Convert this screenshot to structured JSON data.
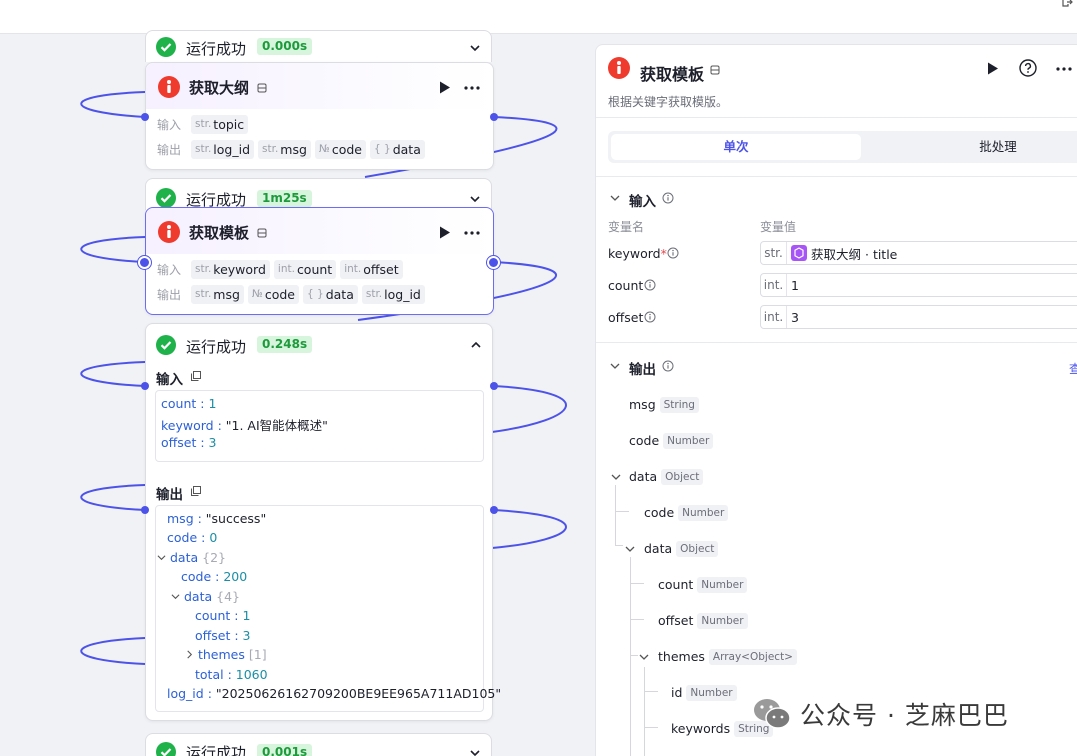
{
  "canvas": {
    "status_success": "运行成功",
    "times": [
      "0.000s",
      "1m25s",
      "0.248s",
      "0.001s"
    ]
  },
  "node_outline": {
    "title": "获取大纲",
    "input_label": "输入",
    "output_label": "输出",
    "inputs": [
      {
        "type": "str.",
        "name": "topic"
      }
    ],
    "outputs": [
      {
        "type": "str.",
        "name": "log_id"
      },
      {
        "type": "str.",
        "name": "msg"
      },
      {
        "type": "№",
        "name": "code"
      },
      {
        "type": "{ }",
        "name": "data"
      }
    ]
  },
  "node_template": {
    "title": "获取模板",
    "input_label": "输入",
    "output_label": "输出",
    "inputs": [
      {
        "type": "str.",
        "name": "keyword"
      },
      {
        "type": "int.",
        "name": "count"
      },
      {
        "type": "int.",
        "name": "offset"
      }
    ],
    "outputs": [
      {
        "type": "str.",
        "name": "msg"
      },
      {
        "type": "№",
        "name": "code"
      },
      {
        "type": "{ }",
        "name": "data"
      },
      {
        "type": "str.",
        "name": "log_id"
      }
    ]
  },
  "run_result": {
    "input_title": "输入",
    "output_title": "输出",
    "input_lines": [
      {
        "key": "count",
        "value": "1",
        "kind": "num"
      },
      {
        "key": "keyword",
        "value": "\"1. AI智能体概述\"",
        "kind": "str"
      },
      {
        "key": "offset",
        "value": "3",
        "kind": "num"
      }
    ],
    "output_lines": [
      {
        "key": "msg",
        "value": "\"success\"",
        "kind": "str",
        "count": ""
      },
      {
        "key": "code",
        "value": "0",
        "kind": "num",
        "count": ""
      },
      {
        "key": "data",
        "value": "",
        "kind": "obj",
        "count": "{2}"
      },
      {
        "key": "code",
        "value": "200",
        "kind": "num",
        "count": ""
      },
      {
        "key": "data",
        "value": "",
        "kind": "obj",
        "count": "{4}"
      },
      {
        "key": "count",
        "value": "1",
        "kind": "num",
        "count": ""
      },
      {
        "key": "offset",
        "value": "3",
        "kind": "num",
        "count": ""
      },
      {
        "key": "themes",
        "value": "",
        "kind": "obj",
        "count": "[1]"
      },
      {
        "key": "total",
        "value": "1060",
        "kind": "num",
        "count": ""
      },
      {
        "key": "log_id",
        "value": "\"20250626162709200BE9EE965A711AD105\"",
        "kind": "str",
        "count": ""
      }
    ]
  },
  "panel": {
    "title": "获取模板",
    "description": "根据关键字获取模版。",
    "tabs": [
      "单次",
      "批处理"
    ],
    "input_section": "输入",
    "col_name": "变量名",
    "col_value": "变量值",
    "inputs": [
      {
        "name": "keyword",
        "required": "*",
        "type": "str.",
        "value": "",
        "ref_node": "获取大纲",
        "ref_field": "title"
      },
      {
        "name": "count",
        "required": "",
        "type": "int.",
        "value": "1"
      },
      {
        "name": "offset",
        "required": "",
        "type": "int.",
        "value": "3"
      }
    ],
    "output_section": "输出",
    "view_link": "查",
    "outputs": [
      {
        "name": "msg",
        "type": "String"
      },
      {
        "name": "code",
        "type": "Number"
      },
      {
        "name": "data",
        "type": "Object"
      },
      {
        "name": "code",
        "type": "Number"
      },
      {
        "name": "data",
        "type": "Object"
      },
      {
        "name": "count",
        "type": "Number"
      },
      {
        "name": "offset",
        "type": "Number"
      },
      {
        "name": "themes",
        "type": "Array<Object>"
      },
      {
        "name": "id",
        "type": "Number"
      },
      {
        "name": "keywords",
        "type": "String"
      }
    ]
  },
  "watermark": {
    "text": "公众号 · 芝麻巴巴"
  },
  "colors": {
    "accent": "#4d53e8",
    "success": "#1fb24a",
    "brand": "#ef3b2d"
  }
}
